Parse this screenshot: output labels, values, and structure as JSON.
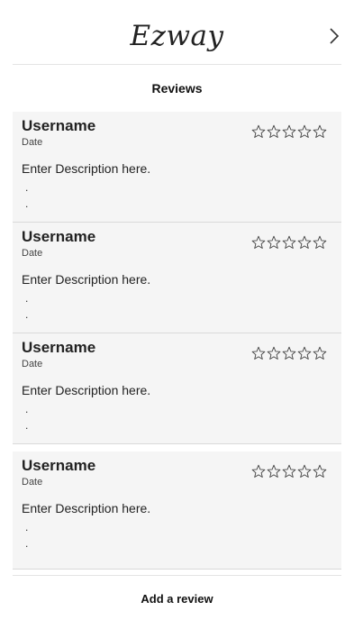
{
  "header": {
    "brand": "Ezway",
    "next_icon": "chevron-right-icon"
  },
  "section_title": "Reviews",
  "reviews": [
    {
      "username": "Username",
      "date": "Date",
      "description": "Enter Description here.",
      "dot1": ".",
      "dot2": ".",
      "rating": 0,
      "max_rating": 5
    },
    {
      "username": "Username",
      "date": "Date",
      "description": "Enter Description here.",
      "dot1": ".",
      "dot2": ".",
      "rating": 0,
      "max_rating": 5
    },
    {
      "username": "Username",
      "date": "Date",
      "description": "Enter Description here.",
      "dot1": ".",
      "dot2": ".",
      "rating": 0,
      "max_rating": 5
    },
    {
      "username": "Username",
      "date": "Date",
      "description": "Enter Description here.",
      "dot1": ".",
      "dot2": ".",
      "rating": 0,
      "max_rating": 5
    }
  ],
  "footer": {
    "add_review_label": "Add a review"
  },
  "colors": {
    "card_bg": "#f5f5f5",
    "divider": "#d9d9d9",
    "text": "#222222"
  }
}
